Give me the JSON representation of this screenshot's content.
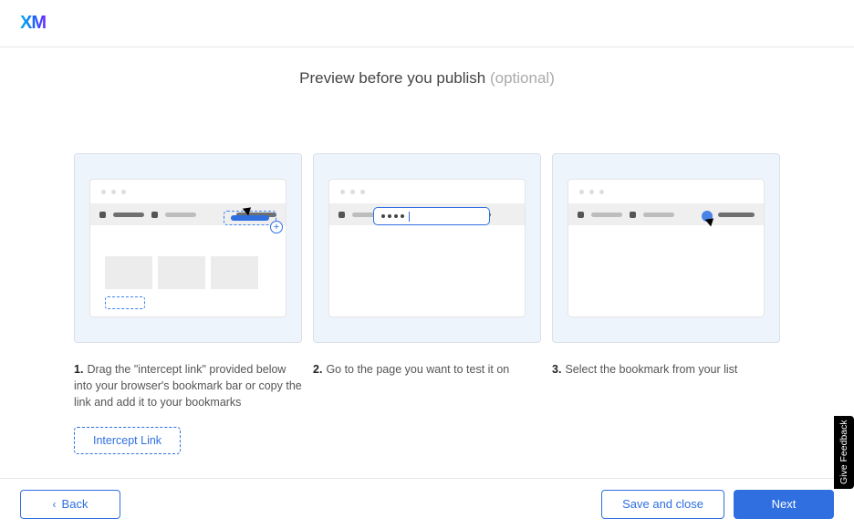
{
  "logo": "XM",
  "title": "Preview before you publish",
  "optional_suffix": "(optional)",
  "steps": [
    {
      "num": "1.",
      "text": "Drag the \"intercept link\" provided below into your browser's bookmark bar or copy the link and add it to your bookmarks"
    },
    {
      "num": "2.",
      "text": "Go to the page you want to test it on"
    },
    {
      "num": "3.",
      "text": "Select the bookmark from your list"
    }
  ],
  "intercept_link_label": "Intercept Link",
  "footer": {
    "back": "Back",
    "save_close": "Save and close",
    "next": "Next"
  },
  "feedback_label": "Give Feedback"
}
